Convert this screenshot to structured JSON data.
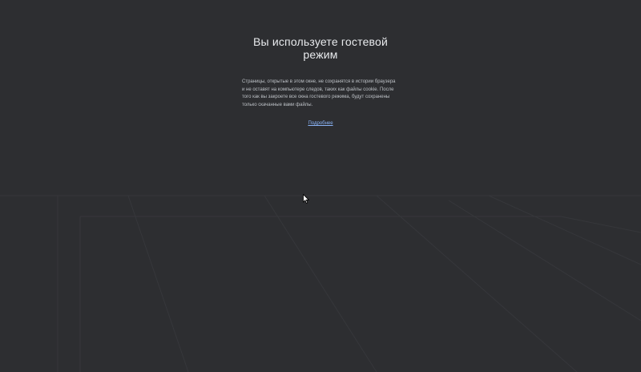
{
  "guest_page": {
    "title": "Вы используете гостевой режим",
    "description": "Страницы, открытые в этом окне, не сохранятся в истории браузера и не оставят на компьютере следов, таких как файлы cookie. После того как вы закроете все окна гостевого режима, будут сохранены только скачанные вами файлы.",
    "learn_more_link": "Подробнее"
  },
  "colors": {
    "background": "#2d2e31",
    "title_text": "#e8eaed",
    "body_text": "#bdc1c6",
    "link": "#8ab4f8"
  },
  "icons": {
    "pointer": "mouse-pointer-icon"
  }
}
